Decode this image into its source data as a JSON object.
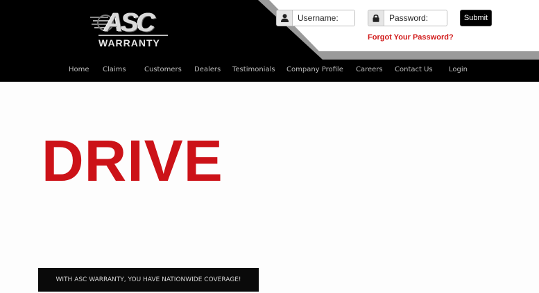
{
  "brand": {
    "logo_top": "ASC",
    "logo_bottom": "WARRANTY",
    "accent_color": "#cc1218"
  },
  "login": {
    "username_icon": "user-icon",
    "username_placeholder": "Username:",
    "password_icon": "lock-icon",
    "password_placeholder": "Password:",
    "submit_label": "Submit",
    "forgot_label": "Forgot Your Password?"
  },
  "nav": {
    "items": [
      {
        "label": "Home"
      },
      {
        "label": "Claims"
      },
      {
        "label": "Customers"
      },
      {
        "label": "Dealers"
      },
      {
        "label": "Testimonials"
      },
      {
        "label": "Company Profile"
      },
      {
        "label": "Careers"
      },
      {
        "label": "Contact Us"
      },
      {
        "label": "Login"
      }
    ]
  },
  "hero": {
    "title": "DRIVE",
    "banner_text": "WITH ASC WARRANTY, YOU HAVE NATIONWIDE COVERAGE!"
  }
}
